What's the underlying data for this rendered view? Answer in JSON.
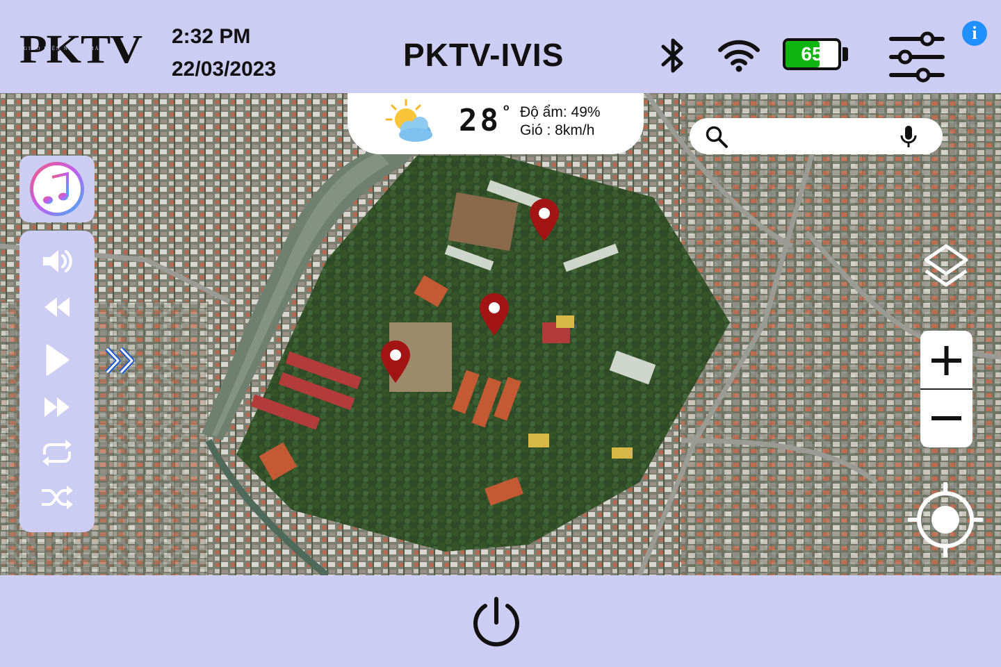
{
  "header": {
    "logo_text": "PKTV",
    "logo_subtitle": "GIAO DIỆN NGƯỜI MÁY",
    "time": "2:32 PM",
    "date": "22/03/2023",
    "app_title": "PKTV-IVIS",
    "battery_level": "65",
    "battery_fraction": 0.65,
    "icons": [
      "bluetooth-icon",
      "wifi-icon",
      "battery-icon",
      "settings-sliders-icon",
      "info-icon"
    ]
  },
  "weather": {
    "temperature": "28",
    "degree_symbol": "°",
    "humidity": "Độ ẩm: 49%",
    "wind": "Gió : 8km/h",
    "icon": "partly-cloudy-icon"
  },
  "search": {
    "value": "",
    "placeholder": ""
  },
  "media": {
    "app_icon": "music-app-icon",
    "controls": [
      "volume-icon",
      "rewind-icon",
      "play-icon",
      "fast-forward-icon",
      "repeat-icon",
      "shuffle-icon"
    ]
  },
  "map_controls": {
    "zoom_in": "+",
    "zoom_out": "−",
    "icons": [
      "layers-icon",
      "zoom-in-icon",
      "zoom-out-icon",
      "locate-icon",
      "expand-panel-icon"
    ]
  },
  "colors": {
    "panel_bg": "#cdcdf3",
    "marker": "#a31515",
    "battery_fill": "#11b511",
    "info": "#1e90ff"
  }
}
